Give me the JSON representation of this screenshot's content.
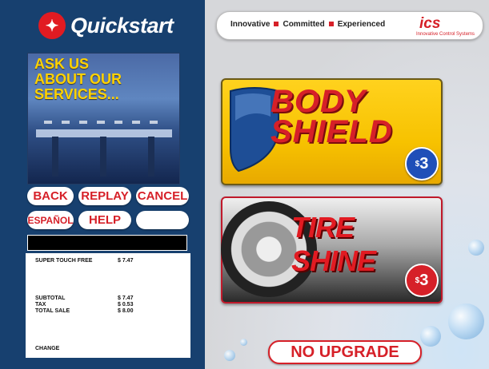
{
  "brand": {
    "name": "Quickstart"
  },
  "promo": {
    "lines": [
      "ASK US",
      "ABOUT OUR",
      "SERVICES..."
    ]
  },
  "controls": {
    "back": "BACK",
    "replay": "REPLAY",
    "cancel": "CANCEL",
    "espanol": "ESPAÑOL",
    "help": "HELP",
    "blank": ""
  },
  "receipt": {
    "item_name": "SUPER TOUCH FREE",
    "item_price": "$  7.47",
    "subtotal_label": "SUBTOTAL",
    "subtotal": "$  7.47",
    "tax_label": "TAX",
    "tax": "$  0.53",
    "total_label": "TOTAL SALE",
    "total": "$  8.00",
    "change_label": "CHANGE"
  },
  "tagline": {
    "words": [
      "Innovative",
      "Committed",
      "Experienced"
    ],
    "company": "ics",
    "company_sub": "Innovative Control Systems"
  },
  "options": [
    {
      "title_line1": "BODY",
      "title_line2": "SHIELD",
      "price": "3",
      "price_symbol": "$",
      "color": "#f7c200"
    },
    {
      "title": "TIRE SHINE",
      "price": "3",
      "price_symbol": "$",
      "color": "#e11b22"
    }
  ],
  "no_upgrade": "NO UPGRADE",
  "colors": {
    "panel_blue": "#17406f",
    "accent_red": "#d62028",
    "blue_badge": "#1f4fb8"
  }
}
